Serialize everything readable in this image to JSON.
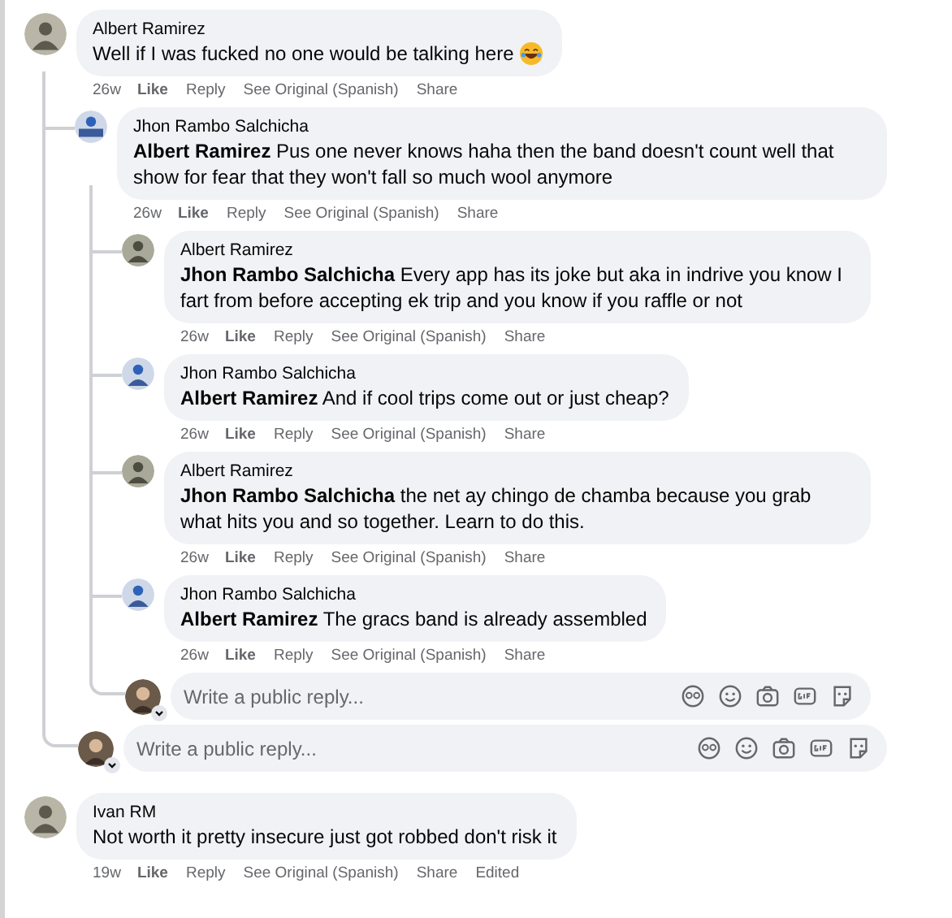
{
  "comments": [
    {
      "author": "Albert Ramirez",
      "text": "Well if I was fucked no one would be talking here",
      "emoji": true,
      "time": "26w",
      "actions": [
        "Like",
        "Reply",
        "See Original (Spanish)",
        "Share"
      ],
      "replies": [
        {
          "author": "Jhon Rambo Salchicha",
          "mention": "Albert Ramirez",
          "text": "Pus one never knows haha then the band doesn't count well that show for fear that they won't fall so much wool anymore",
          "time": "26w",
          "actions": [
            "Like",
            "Reply",
            "See Original (Spanish)",
            "Share"
          ],
          "replies": [
            {
              "author": "Albert Ramirez",
              "mention": "Jhon Rambo Salchicha",
              "text": "Every app has its joke but aka in indrive you know I fart from before accepting ek trip and you know if you raffle or not",
              "time": "26w",
              "actions": [
                "Like",
                "Reply",
                "See Original (Spanish)",
                "Share"
              ]
            },
            {
              "author": "Jhon Rambo Salchicha",
              "mention": "Albert Ramirez",
              "text": "And if cool trips come out or just cheap?",
              "time": "26w",
              "actions": [
                "Like",
                "Reply",
                "See Original (Spanish)",
                "Share"
              ]
            },
            {
              "author": "Albert Ramirez",
              "mention": "Jhon Rambo Salchicha",
              "text": "the net ay chingo de chamba because you grab what hits you and so together. Learn to do this.",
              "time": "26w",
              "actions": [
                "Like",
                "Reply",
                "See Original (Spanish)",
                "Share"
              ]
            },
            {
              "author": "Jhon Rambo Salchicha",
              "mention": "Albert Ramirez",
              "text": "The gracs band is already assembled",
              "time": "26w",
              "actions": [
                "Like",
                "Reply",
                "See Original (Spanish)",
                "Share"
              ]
            }
          ],
          "reply_box": {
            "placeholder": "Write a public reply..."
          }
        }
      ],
      "reply_box": {
        "placeholder": "Write a public reply..."
      }
    },
    {
      "author": "Ivan RM",
      "text": "Not worth it pretty insecure just got robbed don't risk it",
      "emoji": false,
      "time": "19w",
      "actions": [
        "Like",
        "Reply",
        "See Original (Spanish)",
        "Share",
        "Edited"
      ]
    }
  ]
}
